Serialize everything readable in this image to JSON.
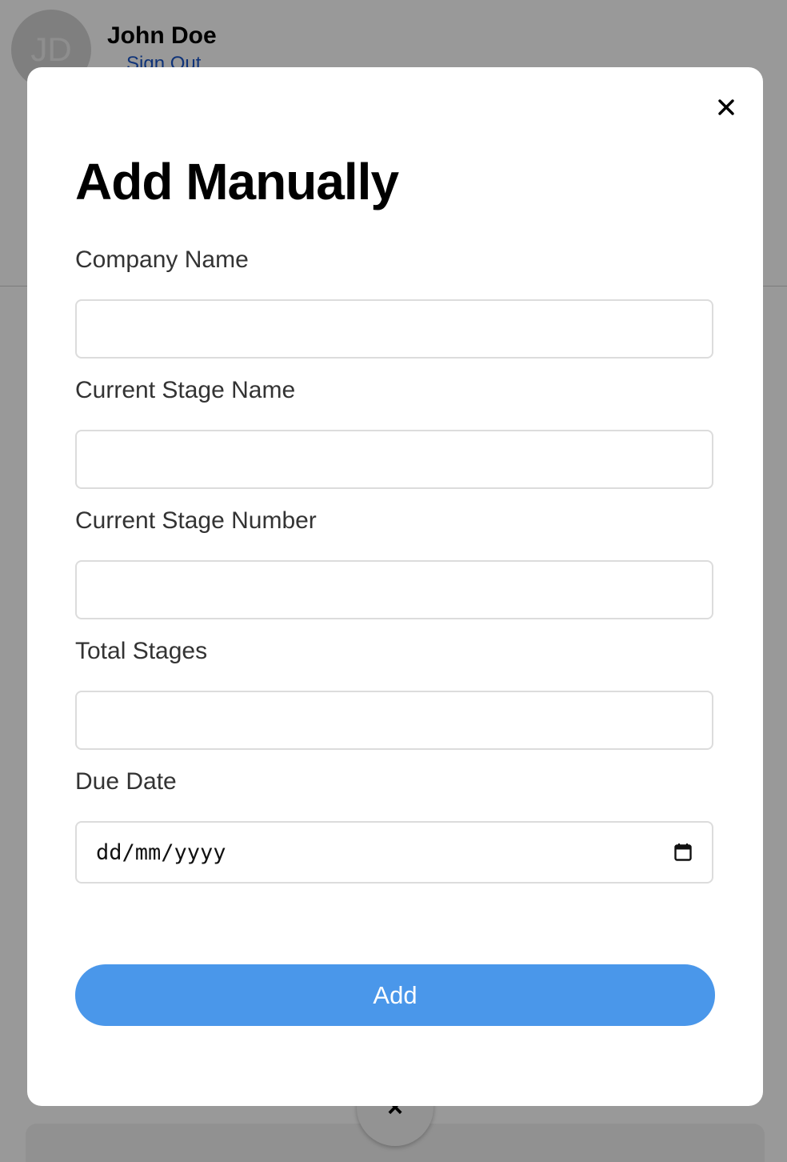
{
  "background": {
    "user": {
      "initials": "JD",
      "name": "John Doe",
      "sign_out_label": "Sign Out"
    },
    "fab_label": "×"
  },
  "modal": {
    "title": "Add Manually",
    "fields": [
      {
        "label": "Company Name",
        "value": ""
      },
      {
        "label": "Current Stage Name",
        "value": ""
      },
      {
        "label": "Current Stage Number",
        "value": ""
      },
      {
        "label": "Total Stages",
        "value": ""
      },
      {
        "label": "Due Date",
        "placeholder": "dd/mm/yyyy"
      }
    ],
    "submit_label": "Add",
    "accent_color": "#4a97ea"
  }
}
